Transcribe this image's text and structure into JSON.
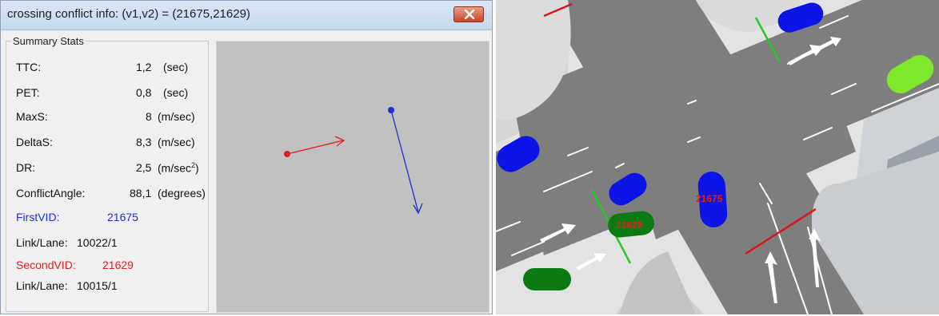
{
  "window": {
    "title": "crossing conflict info: (v1,v2) = (21675,21629)",
    "close_icon": "close-x-icon"
  },
  "summary": {
    "legend": "Summary Stats",
    "ttc": {
      "label": "TTC:",
      "value": "1,2",
      "unit": "(sec)"
    },
    "pet": {
      "label": "PET:",
      "value": "0,8",
      "unit": "(sec)"
    },
    "maxs": {
      "label": "MaxS:",
      "value": "8",
      "unit": "(m/sec)"
    },
    "deltas": {
      "label": "DeltaS:",
      "value": "8,3",
      "unit": "(m/sec)"
    },
    "dr": {
      "label": "DR:",
      "value": "2,5",
      "unit": "(m/sec",
      "unit_sup": "2",
      "unit_close": ")"
    },
    "angle": {
      "label": "ConflictAngle:",
      "value": "88,1",
      "unit": "(degrees)"
    },
    "first": {
      "label": "FirstVID:",
      "value": "21675"
    },
    "first_link": {
      "label": "Link/Lane:",
      "value": "10022/1"
    },
    "second": {
      "label": "SecondVID:",
      "value": "21629"
    },
    "second_link": {
      "label": "Link/Lane:",
      "value": "10015/1"
    }
  },
  "colors": {
    "first_vehicle": "#1f2fd6",
    "second_vehicle": "#e0201a",
    "vehicle_blue": "#0a14e6",
    "vehicle_dark_green": "#0c7a12",
    "vehicle_light_green": "#7ee82a",
    "stop_line_green": "#22cc22",
    "stop_line_red": "#d81818"
  },
  "map": {
    "vehicle_first_label": "21675",
    "vehicle_second_label": "21629"
  }
}
